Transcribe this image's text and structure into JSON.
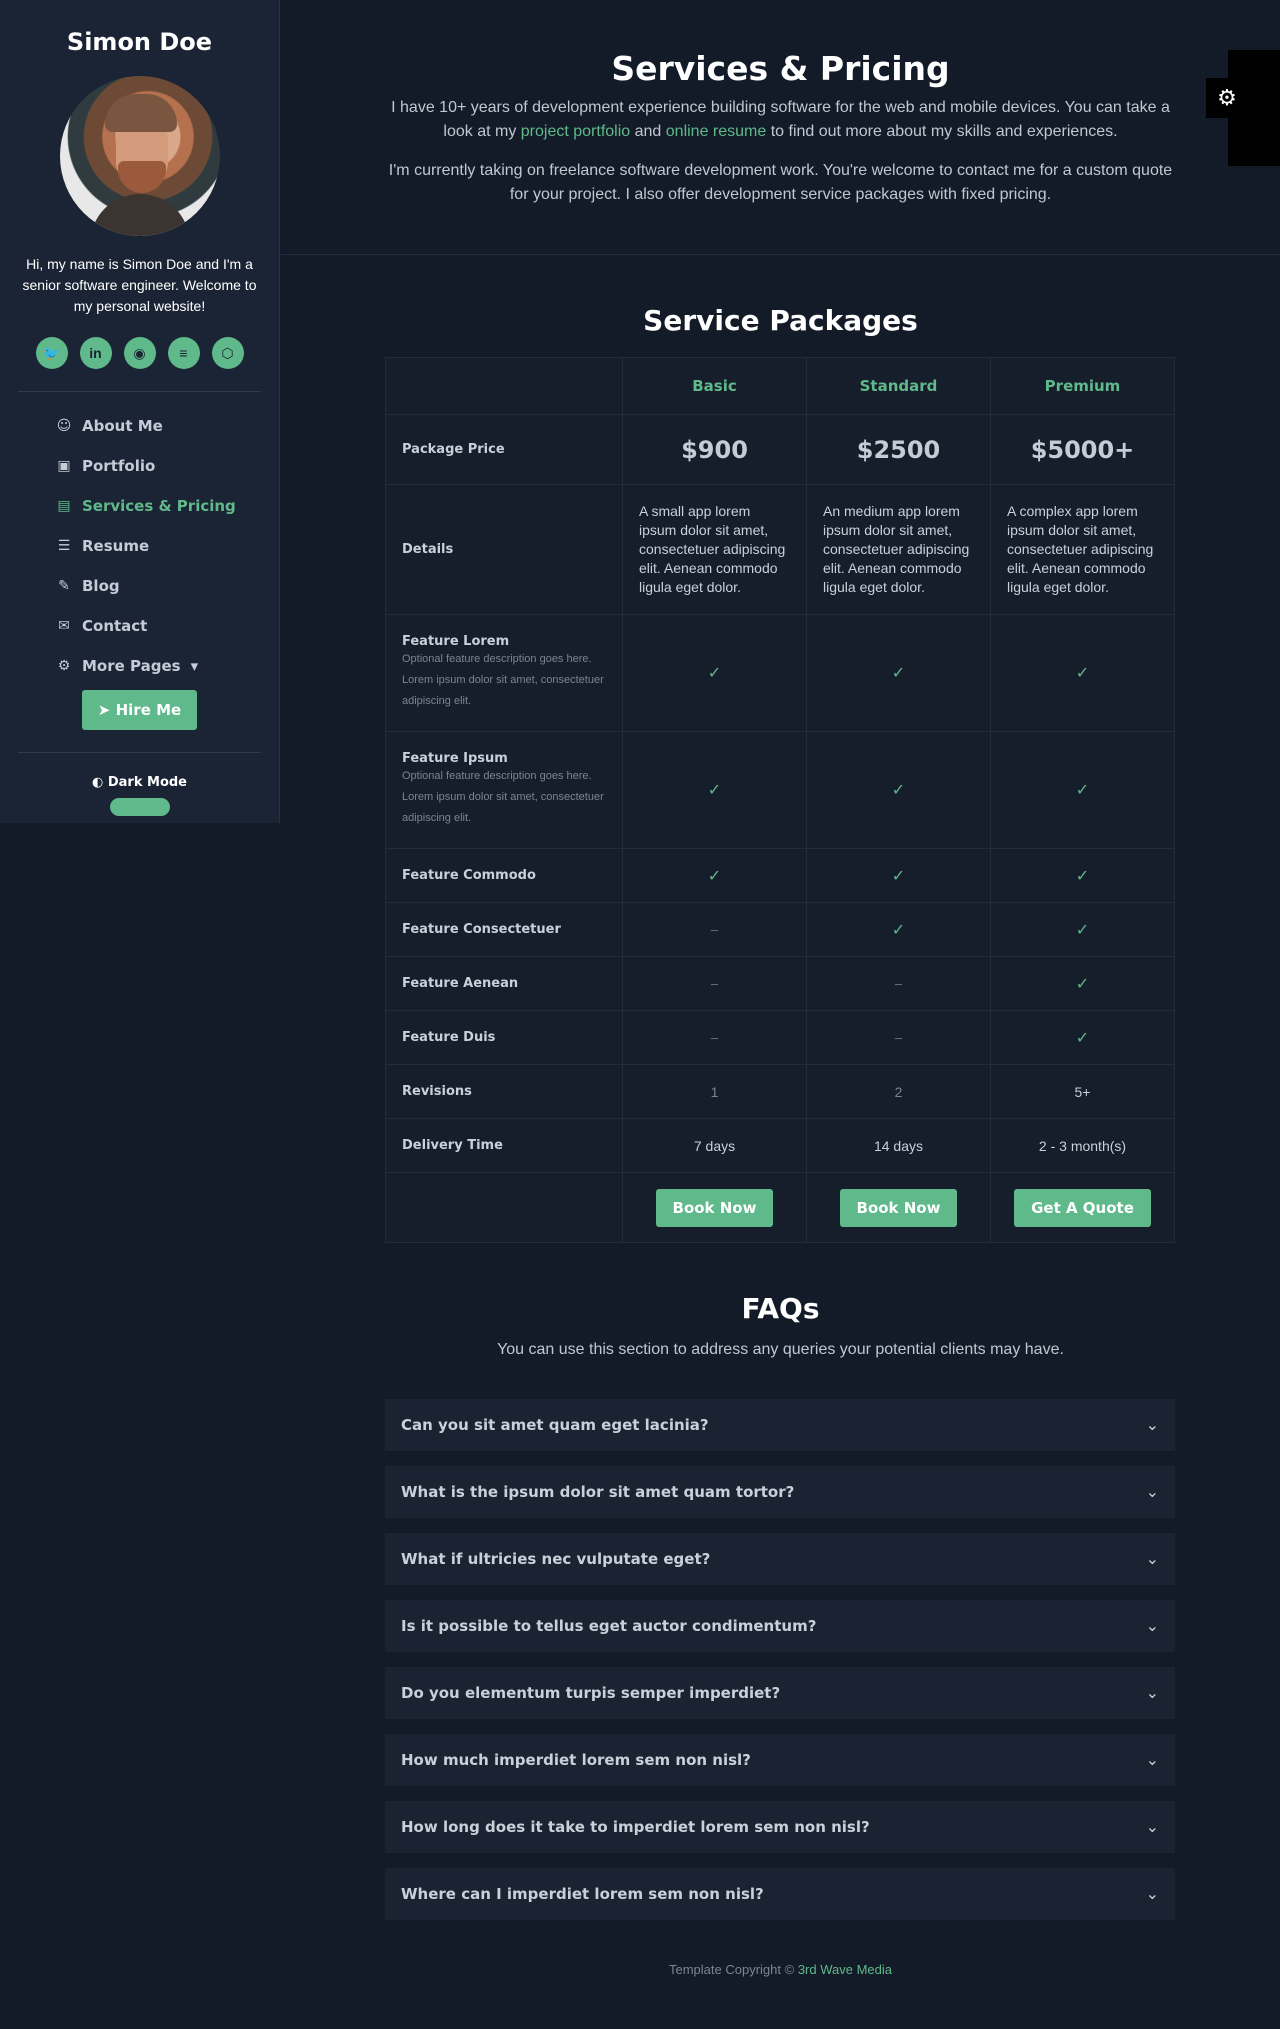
{
  "sidebar": {
    "brand": "Simon Doe",
    "bio": "Hi, my name is Simon Doe and I'm a senior software engineer. Welcome to my personal website!",
    "social": [
      {
        "icon": "twitter-icon",
        "glyph": "🐦"
      },
      {
        "icon": "linkedin-icon",
        "glyph": "in"
      },
      {
        "icon": "github-icon",
        "glyph": "◉"
      },
      {
        "icon": "stack-overflow-icon",
        "glyph": "≡"
      },
      {
        "icon": "codepen-icon",
        "glyph": "⬡"
      }
    ],
    "nav": [
      {
        "label": "About Me",
        "icon": "user-icon",
        "glyph": "☺"
      },
      {
        "label": "Portfolio",
        "icon": "laptop-code-icon",
        "glyph": "▣"
      },
      {
        "label": "Services & Pricing",
        "icon": "briefcase-icon",
        "glyph": "▤",
        "active": true
      },
      {
        "label": "Resume",
        "icon": "file-alt-icon",
        "glyph": "☰"
      },
      {
        "label": "Blog",
        "icon": "blog-icon",
        "glyph": "✎"
      },
      {
        "label": "Contact",
        "icon": "envelope-open-icon",
        "glyph": "✉"
      },
      {
        "label": "More Pages",
        "icon": "cogs-icon",
        "glyph": "⚙"
      }
    ],
    "hire_label": "Hire Me",
    "dark_mode_label": "Dark Mode"
  },
  "hero": {
    "title": "Services & Pricing",
    "p1_pre": "I have 10+ years of development experience building software for the web and mobile devices. You can take a look at my ",
    "p1_link1": "project portfolio",
    "p1_mid": " and ",
    "p1_link2": "online resume",
    "p1_post": " to find out more about my skills and experiences.",
    "p2": "I'm currently taking on freelance software development work. You're welcome to contact me for a custom quote for your project. I also offer development service packages with fixed pricing."
  },
  "packages": {
    "title": "Service Packages",
    "plans": [
      "Basic",
      "Standard",
      "Premium"
    ],
    "price_label": "Package Price",
    "prices": [
      "$900",
      "$2500",
      "$5000+"
    ],
    "details_label": "Details",
    "details": [
      "A small app lorem ipsum dolor sit amet, consectetuer adipiscing elit. Aenean commodo ligula eget dolor.",
      "An medium app lorem ipsum dolor sit amet, consectetuer adipiscing elit. Aenean commodo ligula eget dolor.",
      "A complex app lorem ipsum dolor sit amet, consectetuer adipiscing elit. Aenean commodo ligula eget dolor."
    ],
    "features": [
      {
        "name": "Feature Lorem",
        "desc": "Optional feature description goes here. Lorem ipsum dolor sit amet, consectetuer adipiscing elit.",
        "values": [
          true,
          true,
          true
        ]
      },
      {
        "name": "Feature Ipsum",
        "desc": "Optional feature description goes here. Lorem ipsum dolor sit amet, consectetuer adipiscing elit.",
        "values": [
          true,
          true,
          true
        ]
      },
      {
        "name": "Feature Commodo",
        "desc": "",
        "values": [
          true,
          true,
          true
        ]
      },
      {
        "name": "Feature Consectetuer",
        "desc": "",
        "values": [
          false,
          true,
          true
        ]
      },
      {
        "name": "Feature Aenean",
        "desc": "",
        "values": [
          false,
          false,
          true
        ]
      },
      {
        "name": "Feature Duis",
        "desc": "",
        "values": [
          false,
          false,
          true
        ]
      }
    ],
    "dash": "–",
    "check": "✓",
    "revisions_label": "Revisions",
    "revisions": [
      "1",
      "2",
      "5+"
    ],
    "delivery_label": "Delivery Time",
    "delivery": [
      "7 days",
      "14 days",
      "2 - 3 month(s)"
    ],
    "buttons": [
      "Book Now",
      "Book Now",
      "Get A Quote"
    ]
  },
  "faq": {
    "title": "FAQs",
    "intro": "You can use this section to address any queries your potential clients may have.",
    "questions": [
      "Can you sit amet quam eget lacinia?",
      "What is the ipsum dolor sit amet quam tortor?",
      "What if ultricies nec vulputate eget?",
      "Is it possible to tellus eget auctor condimentum?",
      "Do you elementum turpis semper imperdiet?",
      "How much imperdiet lorem sem non nisl?",
      "How long does it take to imperdiet lorem sem non nisl?",
      "Where can I imperdiet lorem sem non nisl?"
    ]
  },
  "footer": {
    "text": "Template Copyright © ",
    "link": "3rd Wave Media"
  },
  "colors": {
    "accent": "#5fb98a",
    "background": "#141b28",
    "sidebar": "#1b2434"
  }
}
